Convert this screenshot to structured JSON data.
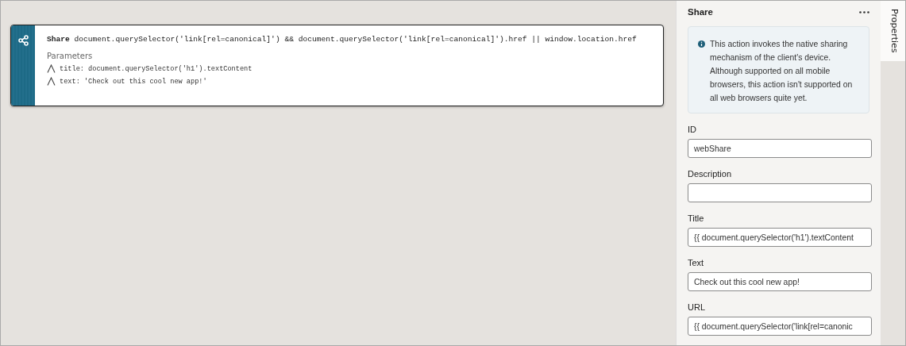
{
  "card": {
    "title": "Share",
    "expression": "document.querySelector('link[rel=canonical]') && document.querySelector('link[rel=canonical]').href || window.location.href",
    "parameters_label": "Parameters",
    "parameters": [
      {
        "text": "title: document.querySelector('h1').textContent"
      },
      {
        "text": "text: 'Check out this cool new app!'"
      }
    ]
  },
  "panel": {
    "title": "Share",
    "info": "This action invokes the native sharing mechanism of the client's device. Although supported on all mobile browsers, this action isn't supported on all web browsers quite yet.",
    "fields": [
      {
        "label": "ID",
        "value": "webShare"
      },
      {
        "label": "Description"
      },
      {
        "label": "Title",
        "value": "{{ document.querySelector('h1').textContent"
      },
      {
        "label": "Text",
        "value": "Check out this cool new app!"
      },
      {
        "label": "URL",
        "value": "{{ document.querySelector('link[rel=canonic"
      }
    ]
  },
  "side_tabs": [
    {
      "label": "Properties",
      "selected": true
    }
  ]
}
